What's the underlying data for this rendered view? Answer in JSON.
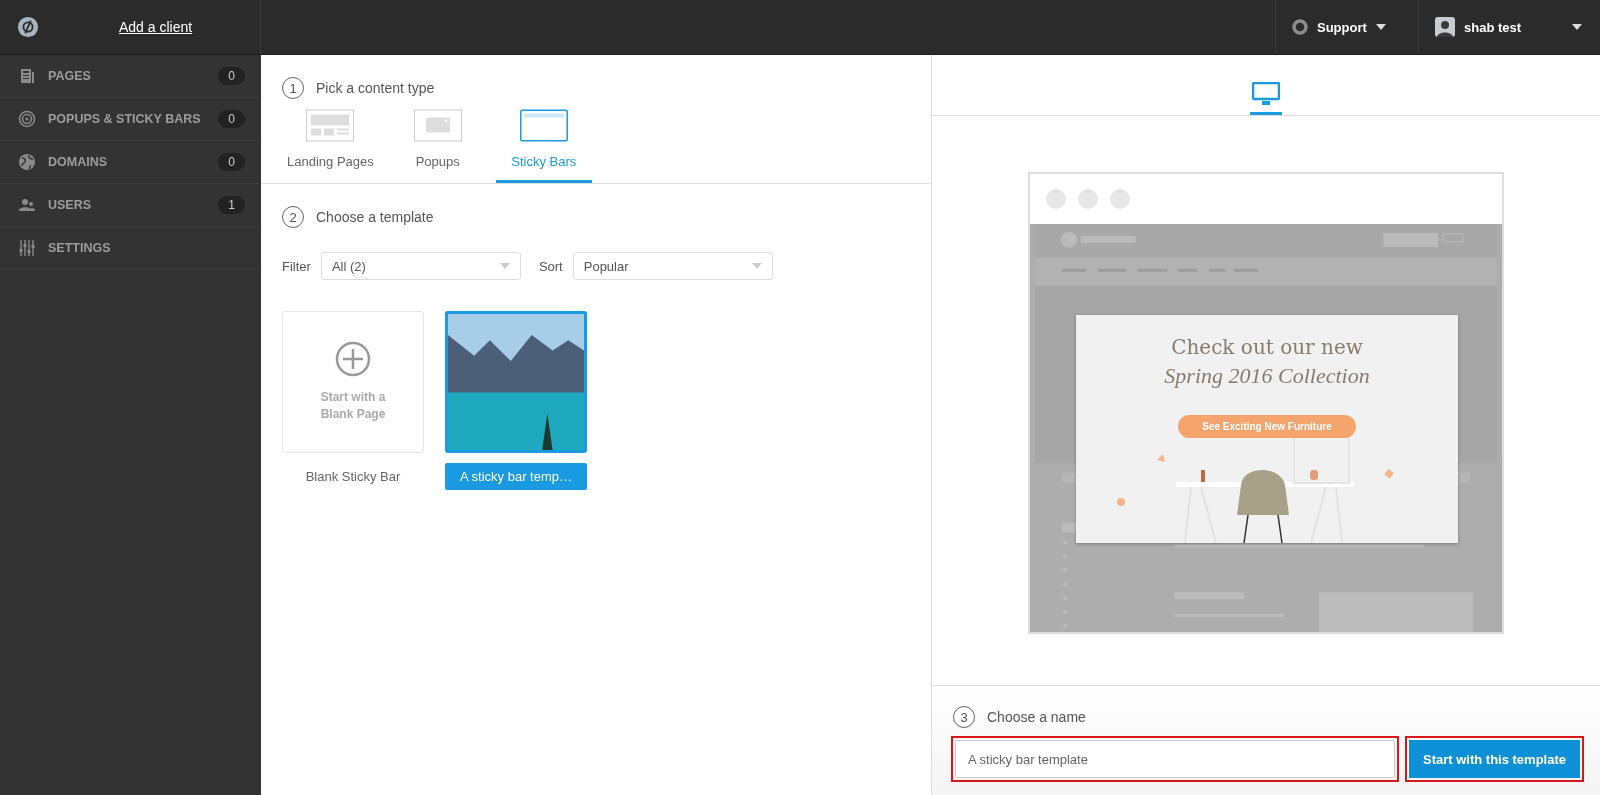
{
  "topbar": {
    "add_client": "Add a client",
    "support": "Support",
    "user": "shab test"
  },
  "sidebar": {
    "items": [
      {
        "label": "PAGES",
        "count": "0"
      },
      {
        "label": "POPUPS & STICKY BARS",
        "count": "0"
      },
      {
        "label": "DOMAINS",
        "count": "0"
      },
      {
        "label": "USERS",
        "count": "1"
      },
      {
        "label": "SETTINGS"
      }
    ]
  },
  "step1": {
    "number": "1",
    "title": "Pick a content type"
  },
  "content_types": [
    {
      "label": "Landing Pages",
      "selected": false
    },
    {
      "label": "Popups",
      "selected": false
    },
    {
      "label": "Sticky Bars",
      "selected": true
    }
  ],
  "step2": {
    "number": "2",
    "title": "Choose a template"
  },
  "filter": {
    "label": "Filter",
    "value": "All (2)"
  },
  "sort": {
    "label": "Sort",
    "value": "Popular"
  },
  "templates": [
    {
      "kind": "blank",
      "caption": "Start with a Blank Page",
      "label": "Blank Sticky Bar",
      "selected": false
    },
    {
      "kind": "image",
      "label": "A sticky bar temp…",
      "selected": true
    }
  ],
  "devices": [
    {
      "selected": true
    }
  ],
  "preview": {
    "headline": "Check out our new",
    "subheadline": "Spring 2016 Collection",
    "cta": "See Exciting New Furniture"
  },
  "step3": {
    "number": "3",
    "title": "Choose a name"
  },
  "name_field": {
    "value": "A sticky bar template",
    "highlighted": true
  },
  "start_button": {
    "label": "Start with this template",
    "highlighted": true
  }
}
